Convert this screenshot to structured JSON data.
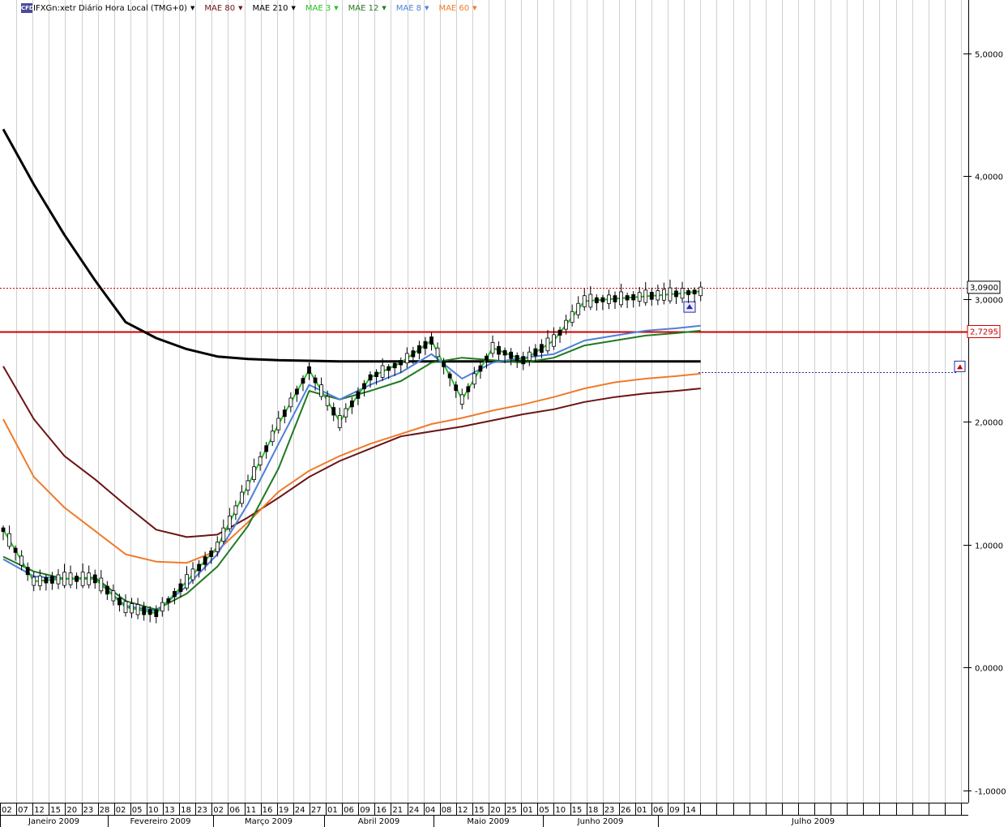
{
  "legend": {
    "symbol": "IFXGn:xetr Diário Hora Local (TMG+0)",
    "logo_text": "CFD",
    "indicators": [
      {
        "label": "MAE 80",
        "color": "#6b1414"
      },
      {
        "label": "MAE 210",
        "color": "#000000"
      },
      {
        "label": "MAE 3",
        "color": "#22c322"
      },
      {
        "label": "MAE 12",
        "color": "#1f7a1f"
      },
      {
        "label": "MAE 8",
        "color": "#4f7fd9"
      },
      {
        "label": "MAE 60",
        "color": "#f07a2a"
      }
    ]
  },
  "price_markers": {
    "last_price": "3,0900",
    "resistance": "2,7295"
  },
  "chart_data": {
    "type": "line",
    "title": "IFXGn:xetr Diário Hora Local (TMG+0)",
    "y_range": [
      -1.0,
      5.5
    ],
    "y_ticks": [
      "5,0000",
      "4,0000",
      "3,0000",
      "2,0000",
      "1,0000",
      "0,0000",
      "-1,0000"
    ],
    "y_tick_values": [
      5,
      4,
      3,
      2,
      1,
      0,
      -1
    ],
    "x_ticks": [
      "02",
      "07",
      "12",
      "15",
      "20",
      "23",
      "28",
      "02",
      "05",
      "10",
      "13",
      "18",
      "23",
      "02",
      "06",
      "11",
      "16",
      "19",
      "24",
      "27",
      "01",
      "06",
      "09",
      "16",
      "21",
      "24",
      "04",
      "08",
      "12",
      "15",
      "20",
      "25",
      "01",
      "05",
      "10",
      "15",
      "18",
      "23",
      "26",
      "01",
      "06",
      "09",
      "14"
    ],
    "months": [
      "Janeiro 2009",
      "Fevereiro 2009",
      "Março 2009",
      "Abril 2009",
      "Maio 2009",
      "Junho 2009",
      "Julho 2009"
    ],
    "horizontal_lines": [
      {
        "name": "last_price",
        "value": 3.09,
        "style": "dotted",
        "color": "#cc0000"
      },
      {
        "name": "resistance",
        "value": 2.7295,
        "style": "solid",
        "color": "#cc0000"
      },
      {
        "name": "alert",
        "value": 2.4,
        "style": "dotted",
        "color": "#2a2aa0"
      }
    ],
    "sessions_x": [
      0,
      5,
      10,
      15,
      20,
      25,
      30,
      35,
      40,
      45,
      50,
      55,
      60,
      65,
      70,
      75,
      80,
      85,
      90,
      95,
      100,
      105,
      110,
      114
    ],
    "series": [
      {
        "name": "MAE 210",
        "color": "#000000",
        "width": 3,
        "values": [
          4.38,
          3.93,
          3.52,
          3.15,
          2.81,
          2.68,
          2.59,
          2.53,
          2.51,
          2.5,
          2.495,
          2.49,
          2.49,
          2.49,
          2.49,
          2.49,
          2.49,
          2.49,
          2.49,
          2.49,
          2.49,
          2.49,
          2.49,
          2.49
        ]
      },
      {
        "name": "MAE 80",
        "color": "#6b1414",
        "width": 2,
        "values": [
          2.45,
          2.02,
          1.72,
          1.53,
          1.32,
          1.12,
          1.06,
          1.08,
          1.22,
          1.38,
          1.55,
          1.68,
          1.78,
          1.88,
          1.92,
          1.96,
          2.01,
          2.06,
          2.1,
          2.16,
          2.2,
          2.23,
          2.25,
          2.27
        ]
      },
      {
        "name": "MAE 60",
        "color": "#f07a2a",
        "width": 2,
        "values": [
          2.02,
          1.55,
          1.3,
          1.11,
          0.92,
          0.86,
          0.85,
          0.95,
          1.18,
          1.43,
          1.6,
          1.72,
          1.82,
          1.9,
          1.98,
          2.03,
          2.09,
          2.14,
          2.2,
          2.27,
          2.32,
          2.35,
          2.37,
          2.39
        ]
      },
      {
        "name": "MAE 12",
        "color": "#1f7a1f",
        "width": 2,
        "values": [
          0.9,
          0.78,
          0.72,
          0.73,
          0.54,
          0.47,
          0.6,
          0.82,
          1.15,
          1.62,
          2.25,
          2.18,
          2.25,
          2.33,
          2.48,
          2.52,
          2.5,
          2.48,
          2.52,
          2.62,
          2.66,
          2.7,
          2.72,
          2.74
        ]
      },
      {
        "name": "MAE 8",
        "color": "#4f7fd9",
        "width": 2,
        "values": [
          0.88,
          0.74,
          0.72,
          0.72,
          0.5,
          0.46,
          0.66,
          0.92,
          1.33,
          1.82,
          2.3,
          2.18,
          2.3,
          2.4,
          2.55,
          2.35,
          2.48,
          2.52,
          2.55,
          2.66,
          2.7,
          2.74,
          2.76,
          2.78
        ]
      },
      {
        "name": "MAE 3",
        "color": "#22c322",
        "width": 2,
        "values": [
          1.12,
          0.7,
          0.72,
          0.72,
          0.49,
          0.44,
          0.7,
          0.98,
          1.48,
          1.98,
          2.42,
          2.0,
          2.36,
          2.48,
          2.66,
          2.18,
          2.6,
          2.5,
          2.66,
          2.98,
          3.0,
          3.02,
          3.04,
          3.06
        ]
      }
    ]
  }
}
